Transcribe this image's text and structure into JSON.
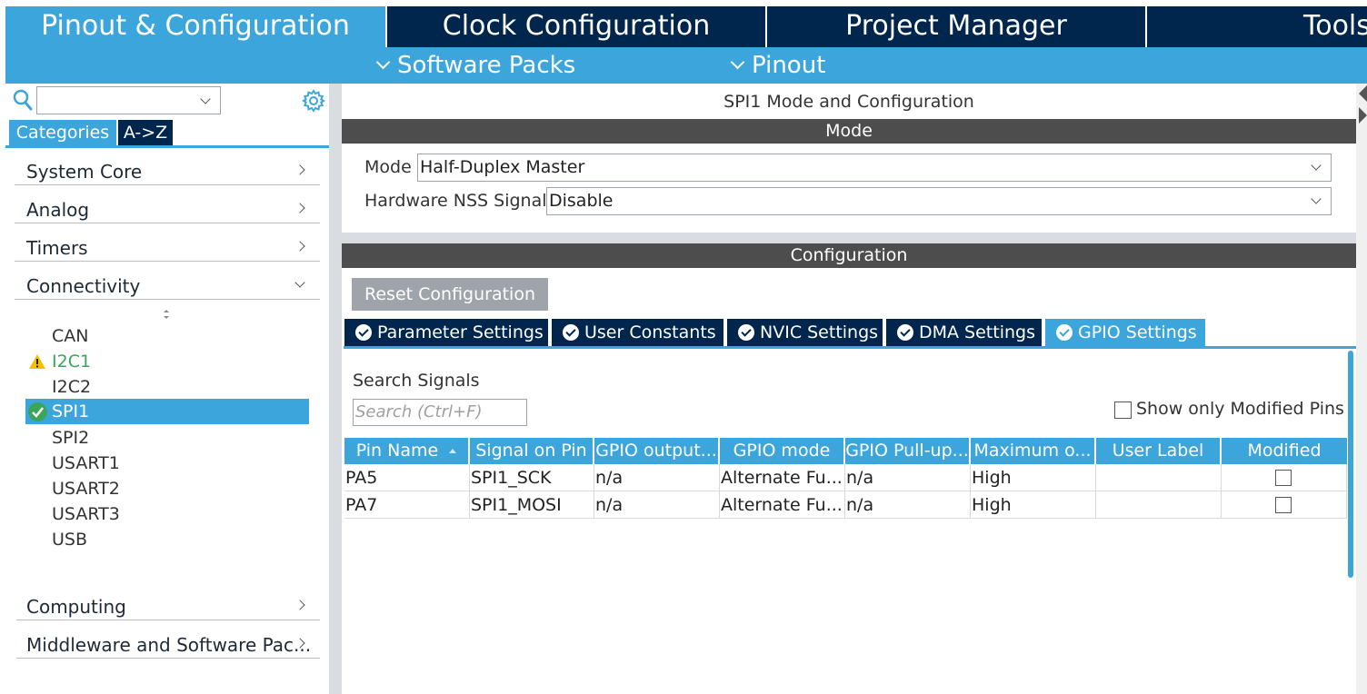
{
  "top_tabs": [
    {
      "label": "Pinout & Configuration"
    },
    {
      "label": "Clock Configuration"
    },
    {
      "label": "Project Manager"
    },
    {
      "label": "Tools"
    }
  ],
  "sub_menu": {
    "software_packs": "Software Packs",
    "pinout": "Pinout"
  },
  "left": {
    "search_value": "",
    "tabs": {
      "categories": "Categories",
      "az": "A->Z"
    },
    "categories": [
      {
        "label": "System Core"
      },
      {
        "label": "Analog"
      },
      {
        "label": "Timers"
      },
      {
        "label": "Connectivity"
      },
      {
        "label": "Computing"
      },
      {
        "label": "Middleware and Software Pac..."
      }
    ],
    "connectivity_items": [
      {
        "label": "CAN"
      },
      {
        "label": "I2C1",
        "status": "warning"
      },
      {
        "label": "I2C2"
      },
      {
        "label": "SPI1",
        "status": "ok"
      },
      {
        "label": "SPI2"
      },
      {
        "label": "USART1"
      },
      {
        "label": "USART2"
      },
      {
        "label": "USART3"
      },
      {
        "label": "USB"
      }
    ]
  },
  "panel": {
    "title": "SPI1 Mode and Configuration",
    "mode_header": "Mode",
    "mode_label": "Mode",
    "mode_value": "Half-Duplex Master",
    "nss_label": "Hardware NSS Signal",
    "nss_value": "Disable",
    "config_header": "Configuration",
    "reset_button": "Reset Configuration",
    "config_tabs": [
      {
        "label": "Parameter Settings"
      },
      {
        "label": "User Constants"
      },
      {
        "label": "NVIC Settings"
      },
      {
        "label": "DMA Settings"
      },
      {
        "label": "GPIO Settings",
        "active": true
      }
    ],
    "search_signals_label": "Search Signals",
    "search_placeholder": "Search (Ctrl+F)",
    "show_modified_label": "Show only Modified Pins",
    "table": {
      "columns": [
        "Pin Name",
        "Signal on Pin",
        "GPIO output...",
        "GPIO mode",
        "GPIO Pull-up...",
        "Maximum o...",
        "User Label",
        "Modified"
      ],
      "rows": [
        [
          "PA5",
          "SPI1_SCK",
          "n/a",
          "Alternate Fu...",
          "n/a",
          "High",
          "",
          ""
        ],
        [
          "PA7",
          "SPI1_MOSI",
          "n/a",
          "Alternate Fu...",
          "n/a",
          "High",
          "",
          ""
        ]
      ]
    }
  },
  "colors": {
    "accent": "#3ca6dc",
    "navy": "#00264d",
    "dark_bar": "#4d4d4d",
    "warn": "#f2c200",
    "ok": "#3ba65a"
  }
}
